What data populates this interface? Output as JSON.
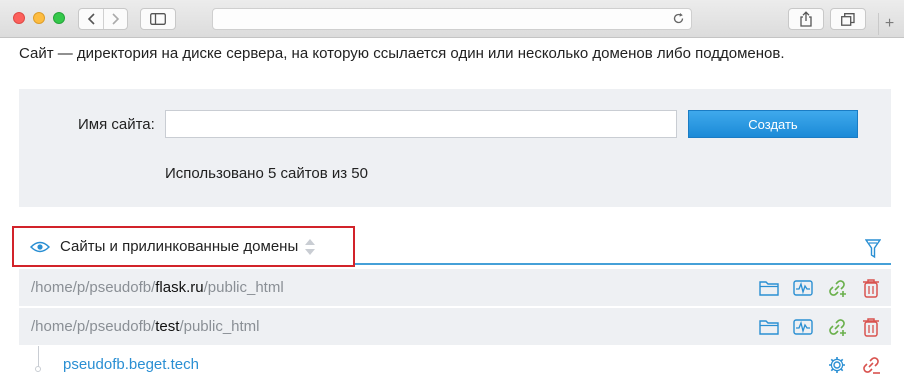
{
  "intro_text": "Сайт — директория на диске сервера, на которую ссылается один или несколько доменов либо поддоменов.",
  "create_form": {
    "site_name_label": "Имя сайта:",
    "site_name_value": "",
    "create_button": "Создать",
    "usage_text": "Использовано 5 сайтов из 50"
  },
  "sites_section": {
    "title": "Сайты и прилинкованные домены"
  },
  "sites": [
    {
      "path_prefix": "/home/p/pseudofb/",
      "name": "flask.ru",
      "path_suffix": "/public_html"
    },
    {
      "path_prefix": "/home/p/pseudofb/",
      "name": "test",
      "path_suffix": "/public_html"
    }
  ],
  "linked_domains": [
    {
      "domain": "pseudofb.beget.tech"
    }
  ],
  "colors": {
    "accent_blue": "#2a8fd3",
    "button_blue": "#1b8ad7",
    "highlight_red": "#d2232a",
    "link_green": "#6ab04c",
    "delete_red": "#d9534f"
  },
  "icons": {
    "eye": "eye-icon",
    "filter": "filter-icon",
    "folder": "folder-icon",
    "stats": "stats-icon",
    "link_add": "link-add-icon",
    "delete": "trash-icon",
    "settings": "gear-icon",
    "unlink": "unlink-icon"
  }
}
